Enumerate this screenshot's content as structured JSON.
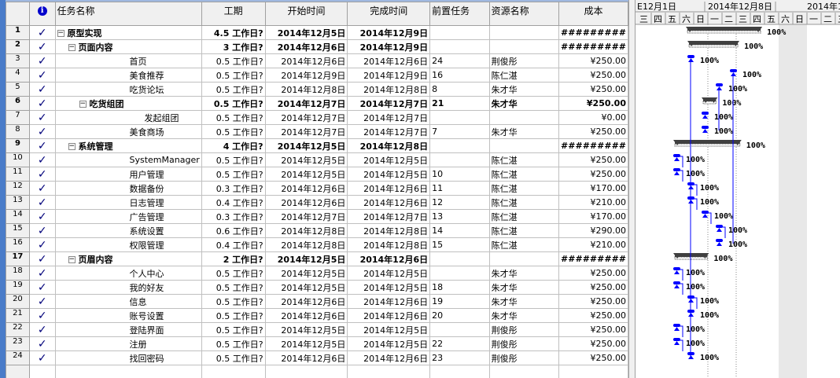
{
  "columns": {
    "info_icon": "info-icon",
    "name": "任务名称",
    "duration": "工期",
    "start": "开始时间",
    "finish": "完成时间",
    "pred": "前置任务",
    "resource": "资源名称",
    "cost": "成本"
  },
  "timescale": {
    "weeks": [
      "E12月1日",
      "2014年12月8日",
      "2014年1"
    ],
    "days": [
      "三",
      "四",
      "五",
      "六",
      "日",
      "一",
      "二",
      "三",
      "四",
      "五",
      "六",
      "日",
      "一",
      "二",
      "三"
    ]
  },
  "colors": {
    "task": "#0000ff",
    "summary": "#404040",
    "check": "#00007a"
  },
  "tasks": [
    {
      "id": "1",
      "level": 0,
      "summary": true,
      "name": "原型实现",
      "duration": "4.5 工作日?",
      "start": "2014年12月5日",
      "finish": "2014年12月9日",
      "pred": "",
      "resource": "",
      "cost": "#########",
      "pct": "100%"
    },
    {
      "id": "2",
      "level": 1,
      "summary": true,
      "name": "页面内容",
      "duration": "3 工作日?",
      "start": "2014年12月6日",
      "finish": "2014年12月9日",
      "pred": "",
      "resource": "",
      "cost": "#########",
      "pct": "100%"
    },
    {
      "id": "3",
      "level": 2,
      "name": "首页",
      "duration": "0.5 工作日?",
      "start": "2014年12月6日",
      "finish": "2014年12月6日",
      "pred": "24",
      "resource": "荆俊彤",
      "cost": "¥250.00",
      "pct": "100%"
    },
    {
      "id": "4",
      "level": 2,
      "name": "美食推荐",
      "duration": "0.5 工作日?",
      "start": "2014年12月9日",
      "finish": "2014年12月9日",
      "pred": "16",
      "resource": "陈仁湛",
      "cost": "¥250.00",
      "pct": "100%"
    },
    {
      "id": "5",
      "level": 2,
      "name": "吃货论坛",
      "duration": "0.5 工作日?",
      "start": "2014年12月8日",
      "finish": "2014年12月8日",
      "pred": "8",
      "resource": "朱才华",
      "cost": "¥250.00",
      "pct": "100%"
    },
    {
      "id": "6",
      "level": 2,
      "summary": true,
      "name": "吃货组团",
      "duration": "0.5 工作日?",
      "start": "2014年12月7日",
      "finish": "2014年12月7日",
      "pred": "21",
      "resource": "朱才华",
      "cost": "¥250.00",
      "pct": "100%"
    },
    {
      "id": "7",
      "level": 3,
      "name": "发起组团",
      "duration": "0.5 工作日?",
      "start": "2014年12月7日",
      "finish": "2014年12月7日",
      "pred": "",
      "resource": "",
      "cost": "¥0.00",
      "pct": "100%"
    },
    {
      "id": "8",
      "level": 2,
      "name": "美食商场",
      "duration": "0.5 工作日?",
      "start": "2014年12月7日",
      "finish": "2014年12月7日",
      "pred": "7",
      "resource": "朱才华",
      "cost": "¥250.00",
      "pct": "100%"
    },
    {
      "id": "9",
      "level": 1,
      "summary": true,
      "name": "系统管理",
      "duration": "4 工作日?",
      "start": "2014年12月5日",
      "finish": "2014年12月8日",
      "pred": "",
      "resource": "",
      "cost": "#########",
      "pct": "100%"
    },
    {
      "id": "10",
      "level": 2,
      "name": "SystemManager",
      "duration": "0.5 工作日?",
      "start": "2014年12月5日",
      "finish": "2014年12月5日",
      "pred": "",
      "resource": "陈仁湛",
      "cost": "¥250.00",
      "pct": "100%"
    },
    {
      "id": "11",
      "level": 2,
      "name": "用户管理",
      "duration": "0.5 工作日?",
      "start": "2014年12月5日",
      "finish": "2014年12月5日",
      "pred": "10",
      "resource": "陈仁湛",
      "cost": "¥250.00",
      "pct": "100%"
    },
    {
      "id": "12",
      "level": 2,
      "name": "数据备份",
      "duration": "0.3 工作日?",
      "start": "2014年12月6日",
      "finish": "2014年12月6日",
      "pred": "11",
      "resource": "陈仁湛",
      "cost": "¥170.00",
      "pct": "100%"
    },
    {
      "id": "13",
      "level": 2,
      "name": "日志管理",
      "duration": "0.4 工作日?",
      "start": "2014年12月6日",
      "finish": "2014年12月6日",
      "pred": "12",
      "resource": "陈仁湛",
      "cost": "¥210.00",
      "pct": "100%"
    },
    {
      "id": "14",
      "level": 2,
      "name": "广告管理",
      "duration": "0.3 工作日?",
      "start": "2014年12月7日",
      "finish": "2014年12月7日",
      "pred": "13",
      "resource": "陈仁湛",
      "cost": "¥170.00",
      "pct": "100%"
    },
    {
      "id": "15",
      "level": 2,
      "name": "系统设置",
      "duration": "0.6 工作日?",
      "start": "2014年12月8日",
      "finish": "2014年12月8日",
      "pred": "14",
      "resource": "陈仁湛",
      "cost": "¥290.00",
      "pct": "100%"
    },
    {
      "id": "16",
      "level": 2,
      "name": "权限管理",
      "duration": "0.4 工作日?",
      "start": "2014年12月8日",
      "finish": "2014年12月8日",
      "pred": "15",
      "resource": "陈仁湛",
      "cost": "¥210.00",
      "pct": "100%"
    },
    {
      "id": "17",
      "level": 1,
      "summary": true,
      "name": "页眉内容",
      "duration": "2 工作日?",
      "start": "2014年12月5日",
      "finish": "2014年12月6日",
      "pred": "",
      "resource": "",
      "cost": "#########",
      "pct": "100%"
    },
    {
      "id": "18",
      "level": 2,
      "name": "个人中心",
      "duration": "0.5 工作日?",
      "start": "2014年12月5日",
      "finish": "2014年12月5日",
      "pred": "",
      "resource": "朱才华",
      "cost": "¥250.00",
      "pct": "100%"
    },
    {
      "id": "19",
      "level": 2,
      "name": "我的好友",
      "duration": "0.5 工作日?",
      "start": "2014年12月5日",
      "finish": "2014年12月5日",
      "pred": "18",
      "resource": "朱才华",
      "cost": "¥250.00",
      "pct": "100%"
    },
    {
      "id": "20",
      "level": 2,
      "name": "信息",
      "duration": "0.5 工作日?",
      "start": "2014年12月6日",
      "finish": "2014年12月6日",
      "pred": "19",
      "resource": "朱才华",
      "cost": "¥250.00",
      "pct": "100%"
    },
    {
      "id": "21",
      "level": 2,
      "name": "账号设置",
      "duration": "0.5 工作日?",
      "start": "2014年12月6日",
      "finish": "2014年12月6日",
      "pred": "20",
      "resource": "朱才华",
      "cost": "¥250.00",
      "pct": "100%"
    },
    {
      "id": "22",
      "level": 2,
      "name": "登陆界面",
      "duration": "0.5 工作日?",
      "start": "2014年12月5日",
      "finish": "2014年12月5日",
      "pred": "",
      "resource": "荆俊彤",
      "cost": "¥250.00",
      "pct": "100%"
    },
    {
      "id": "23",
      "level": 2,
      "name": "注册",
      "duration": "0.5 工作日?",
      "start": "2014年12月5日",
      "finish": "2014年12月5日",
      "pred": "22",
      "resource": "荆俊彤",
      "cost": "¥250.00",
      "pct": "100%"
    },
    {
      "id": "24",
      "level": 2,
      "name": "找回密码",
      "duration": "0.5 工作日?",
      "start": "2014年12月6日",
      "finish": "2014年12月6日",
      "pred": "23",
      "resource": "荆俊彤",
      "cost": "¥250.00",
      "pct": "100%"
    }
  ]
}
